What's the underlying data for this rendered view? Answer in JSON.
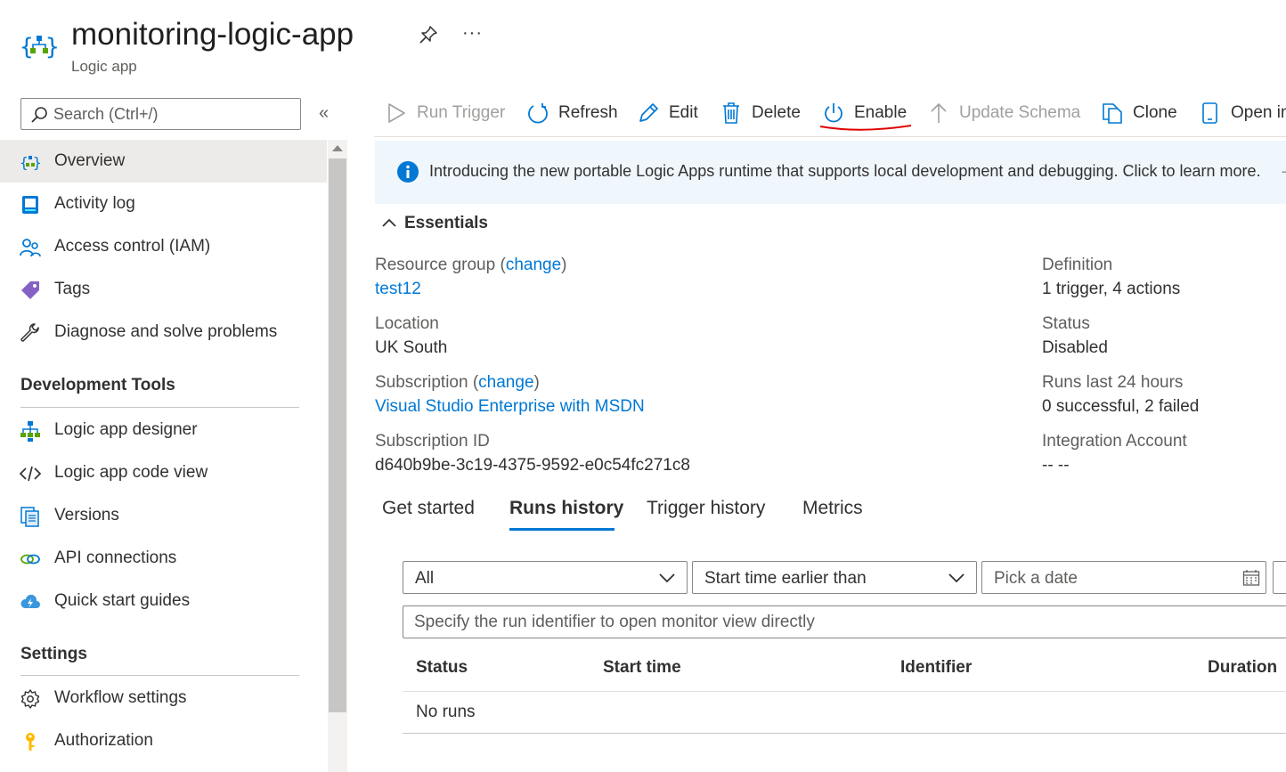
{
  "header": {
    "title": "monitoring-logic-app",
    "subtitle": "Logic app",
    "more_label": "···",
    "icon": "logic-app-icon"
  },
  "sidebar": {
    "search_placeholder": "Search (Ctrl+/)",
    "collapse_label": "«",
    "items": [
      {
        "label": "Overview",
        "icon": "logic-app-icon",
        "active": true
      },
      {
        "label": "Activity log",
        "icon": "activity-log-icon"
      },
      {
        "label": "Access control (IAM)",
        "icon": "people-icon"
      },
      {
        "label": "Tags",
        "icon": "tag-icon"
      },
      {
        "label": "Diagnose and solve problems",
        "icon": "wrench-icon"
      }
    ],
    "sections": [
      {
        "title": "Development Tools",
        "items": [
          {
            "label": "Logic app designer",
            "icon": "designer-icon"
          },
          {
            "label": "Logic app code view",
            "icon": "code-icon"
          },
          {
            "label": "Versions",
            "icon": "versions-icon"
          },
          {
            "label": "API connections",
            "icon": "link-icon"
          },
          {
            "label": "Quick start guides",
            "icon": "cloud-bolt-icon"
          }
        ]
      },
      {
        "title": "Settings",
        "items": [
          {
            "label": "Workflow settings",
            "icon": "gear-icon"
          },
          {
            "label": "Authorization",
            "icon": "key-icon"
          }
        ]
      }
    ]
  },
  "toolbar": {
    "items": [
      {
        "label": "Run Trigger",
        "icon": "play-icon",
        "disabled": true
      },
      {
        "label": "Refresh",
        "icon": "refresh-icon"
      },
      {
        "label": "Edit",
        "icon": "pencil-icon"
      },
      {
        "label": "Delete",
        "icon": "trash-icon"
      },
      {
        "label": "Enable",
        "icon": "power-icon",
        "annotated": true
      },
      {
        "label": "Update Schema",
        "icon": "arrow-up-icon",
        "disabled": true
      },
      {
        "label": "Clone",
        "icon": "copy-icon"
      },
      {
        "label": "Open in mobile",
        "icon": "phone-icon"
      }
    ]
  },
  "banner": {
    "text": "Introducing the new portable Logic Apps runtime that supports local development and debugging. Click to learn more.",
    "trailing": "→"
  },
  "essentials": {
    "title": "Essentials",
    "change_label": "change",
    "left": [
      {
        "label": "Resource group",
        "value": "test12",
        "link": true,
        "change": true
      },
      {
        "label": "Location",
        "value": "UK South"
      },
      {
        "label": "Subscription",
        "value": "Visual Studio Enterprise with MSDN",
        "link": true,
        "change": true
      },
      {
        "label": "Subscription ID",
        "value": "d640b9be-3c19-4375-9592-e0c54fc271c8"
      }
    ],
    "right": [
      {
        "label": "Definition",
        "value": "1 trigger, 4 actions"
      },
      {
        "label": "Status",
        "value": "Disabled"
      },
      {
        "label": "Runs last 24 hours",
        "value": "0 successful, 2 failed"
      },
      {
        "label": "Integration Account",
        "value": "-- --"
      }
    ]
  },
  "tabs": [
    {
      "label": "Get started"
    },
    {
      "label": "Runs history",
      "active": true
    },
    {
      "label": "Trigger history"
    },
    {
      "label": "Metrics"
    }
  ],
  "filters": {
    "status_value": "All",
    "time_value": "Start time earlier than",
    "date_placeholder": "Pick a date",
    "run_id_placeholder": "Specify the run identifier to open monitor view directly"
  },
  "table": {
    "columns": [
      "Status",
      "Start time",
      "Identifier",
      "Duration"
    ],
    "empty_text": "No runs"
  },
  "colors": {
    "accent": "#0078d4",
    "annotation": "#e00000",
    "banner_bg": "#eff6fc",
    "active_nav": "#edebe9"
  }
}
